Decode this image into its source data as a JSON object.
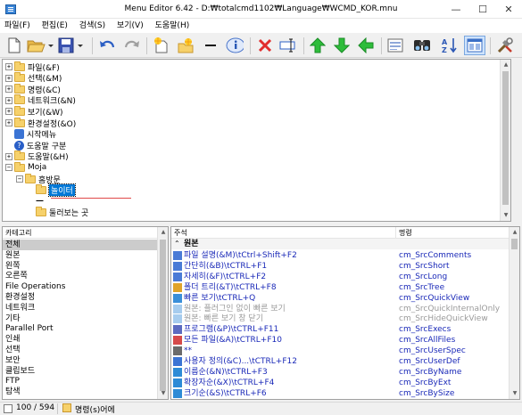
{
  "window": {
    "title": "Menu Editor 6.42 - D:₩totalcmd1102₩Language₩WCMD_KOR.mnu",
    "min": "—",
    "max": "☐",
    "close": "✕"
  },
  "menubar": [
    "파일(F)",
    "편집(E)",
    "검색(S)",
    "보기(V)",
    "도움말(H)"
  ],
  "tree": {
    "items": [
      {
        "label": "파일(&F)",
        "expander": "+",
        "type": "folder"
      },
      {
        "label": "선택(&M)",
        "expander": "+",
        "type": "folder"
      },
      {
        "label": "명령(&C)",
        "expander": "+",
        "type": "folder"
      },
      {
        "label": "네트워크(&N)",
        "expander": "+",
        "type": "folder"
      },
      {
        "label": "보기(&W)",
        "expander": "+",
        "type": "folder"
      },
      {
        "label": "환경설정(&O)",
        "expander": "+",
        "type": "folder"
      },
      {
        "label": "시작메뉴",
        "expander": "",
        "type": "start"
      },
      {
        "label": "도움말 구분",
        "expander": "",
        "type": "help"
      },
      {
        "label": "도움말(&H)",
        "expander": "+",
        "type": "folder"
      },
      {
        "label": "Moja",
        "expander": "−",
        "type": "folder"
      },
      {
        "label": "홈방문",
        "expander": "−",
        "type": "folder"
      },
      {
        "label": "놀이터",
        "expander": "",
        "type": "folder",
        "selected": true
      },
      {
        "label": "—",
        "expander": "",
        "type": "sep"
      },
      {
        "label": "둘러보는 곳",
        "expander": "",
        "type": "folder"
      }
    ]
  },
  "left_panel": {
    "header": "카테고리",
    "items": [
      "전체",
      "원본",
      "왼쪽",
      "오른쪽",
      "File Operations",
      "환경설정",
      "네트워크",
      "기타",
      "Parallel Port",
      "인쇄",
      "선택",
      "보안",
      "클립보드",
      "FTP",
      "탐색"
    ]
  },
  "right_panel": {
    "headers": [
      "주석",
      "명령"
    ],
    "group": "원본",
    "rows": [
      {
        "comment": "파일 설명(&M)\\tCtrl+Shift+F2",
        "command": "cm_SrcComments",
        "dim": false,
        "icon": "grid"
      },
      {
        "comment": "간단히(&B)\\tCTRL+F1",
        "command": "cm_SrcShort",
        "dim": false,
        "icon": "grid"
      },
      {
        "comment": "자세히(&F)\\tCTRL+F2",
        "command": "cm_SrcLong",
        "dim": false,
        "icon": "grid"
      },
      {
        "comment": "폴더 트리(&T)\\tCTRL+F8",
        "command": "cm_SrcTree",
        "dim": false,
        "icon": "tree"
      },
      {
        "comment": "빠른 보기\\tCTRL+Q",
        "command": "cm_SrcQuickView",
        "dim": false,
        "icon": "view"
      },
      {
        "comment": "원본: 플러그인 없이 빠른 보기",
        "command": "cm_SrcQuickInternalOnly",
        "dim": true,
        "icon": "view"
      },
      {
        "comment": "원본: 빠른 보기 창 닫기",
        "command": "cm_SrcHideQuickView",
        "dim": true,
        "icon": "view"
      },
      {
        "comment": "프로그램(&P)\\tCTRL+F11",
        "command": "cm_SrcExecs",
        "dim": false,
        "icon": "prog"
      },
      {
        "comment": "모든 파일(&A)\\tCTRL+F10",
        "command": "cm_SrcAllFiles",
        "dim": false,
        "icon": "files"
      },
      {
        "comment": "**",
        "command": "cm_SrcUserSpec",
        "dim": false,
        "icon": "star"
      },
      {
        "comment": "사용자 정의(&C)...\\tCTRL+F12",
        "command": "cm_SrcUserDef",
        "dim": false,
        "icon": "user"
      },
      {
        "comment": "이름순(&N)\\tCTRL+F3",
        "command": "cm_SrcByName",
        "dim": false,
        "icon": "sort"
      },
      {
        "comment": "확장자순(&X)\\tCTRL+F4",
        "command": "cm_SrcByExt",
        "dim": false,
        "icon": "sort"
      },
      {
        "comment": "크기순(&S)\\tCTRL+F6",
        "command": "cm_SrcBySize",
        "dim": false,
        "icon": "sort"
      }
    ]
  },
  "status": {
    "count": "100 / 594",
    "text": "명령(s)어에"
  },
  "colors": {
    "accent": "#0078d7",
    "link": "#1a29b8",
    "dim": "#9a9a9a",
    "selected": "#0078d7"
  }
}
